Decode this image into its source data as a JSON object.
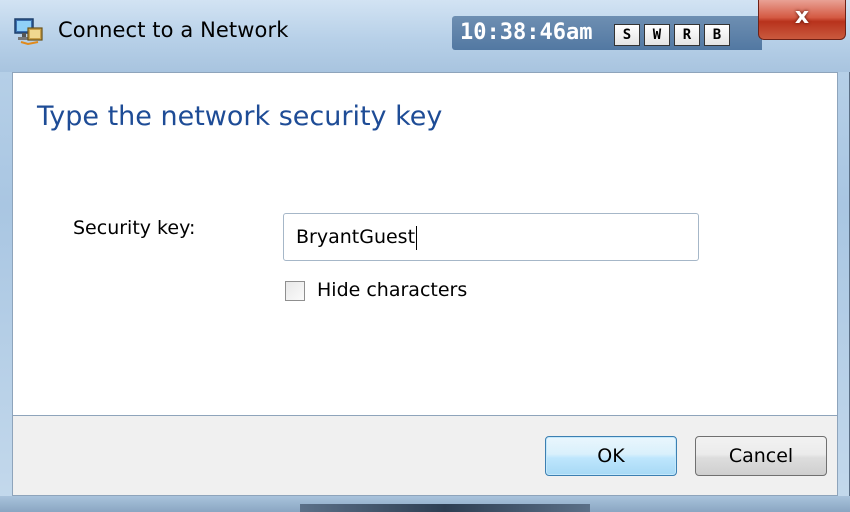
{
  "window": {
    "title": "Connect to a Network",
    "close_symbol": "x"
  },
  "clock": {
    "time": "10:38:46am",
    "buttons": [
      "S",
      "W",
      "R",
      "B"
    ]
  },
  "content": {
    "heading": "Type the network security key",
    "security_key_label": "Security key:",
    "security_key_value": "BryantGuest",
    "hide_characters_label": "Hide characters",
    "hide_characters_checked": false
  },
  "footer": {
    "ok_label": "OK",
    "cancel_label": "Cancel"
  },
  "colors": {
    "heading": "#1e4c96",
    "close_button": "#c94a32",
    "ok_button_border": "#3c7fb1"
  },
  "icons": {
    "title_icon": "network-icon",
    "close_icon": "close-icon"
  }
}
